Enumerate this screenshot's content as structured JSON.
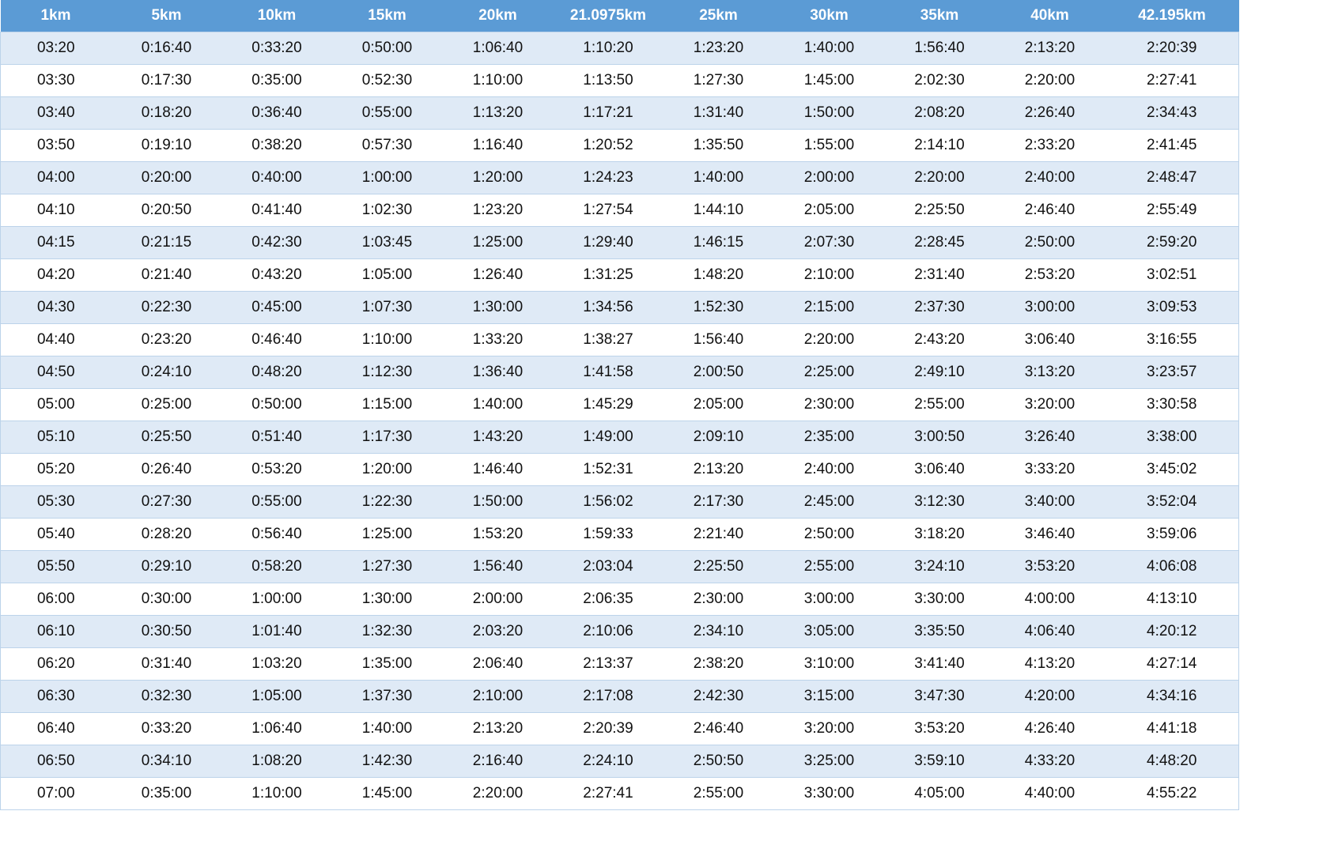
{
  "colors": {
    "header_bg": "#5b9bd5",
    "header_text": "#ffffff",
    "row_alt_bg": "#dfeaf6",
    "row_bg": "#ffffff",
    "border": "#bcd3ea"
  },
  "table": {
    "headers": [
      "1km",
      "5km",
      "10km",
      "15km",
      "20km",
      "21.0975km",
      "25km",
      "30km",
      "35km",
      "40km",
      "42.195km"
    ],
    "rows": [
      [
        "03:20",
        "0:16:40",
        "0:33:20",
        "0:50:00",
        "1:06:40",
        "1:10:20",
        "1:23:20",
        "1:40:00",
        "1:56:40",
        "2:13:20",
        "2:20:39"
      ],
      [
        "03:30",
        "0:17:30",
        "0:35:00",
        "0:52:30",
        "1:10:00",
        "1:13:50",
        "1:27:30",
        "1:45:00",
        "2:02:30",
        "2:20:00",
        "2:27:41"
      ],
      [
        "03:40",
        "0:18:20",
        "0:36:40",
        "0:55:00",
        "1:13:20",
        "1:17:21",
        "1:31:40",
        "1:50:00",
        "2:08:20",
        "2:26:40",
        "2:34:43"
      ],
      [
        "03:50",
        "0:19:10",
        "0:38:20",
        "0:57:30",
        "1:16:40",
        "1:20:52",
        "1:35:50",
        "1:55:00",
        "2:14:10",
        "2:33:20",
        "2:41:45"
      ],
      [
        "04:00",
        "0:20:00",
        "0:40:00",
        "1:00:00",
        "1:20:00",
        "1:24:23",
        "1:40:00",
        "2:00:00",
        "2:20:00",
        "2:40:00",
        "2:48:47"
      ],
      [
        "04:10",
        "0:20:50",
        "0:41:40",
        "1:02:30",
        "1:23:20",
        "1:27:54",
        "1:44:10",
        "2:05:00",
        "2:25:50",
        "2:46:40",
        "2:55:49"
      ],
      [
        "04:15",
        "0:21:15",
        "0:42:30",
        "1:03:45",
        "1:25:00",
        "1:29:40",
        "1:46:15",
        "2:07:30",
        "2:28:45",
        "2:50:00",
        "2:59:20"
      ],
      [
        "04:20",
        "0:21:40",
        "0:43:20",
        "1:05:00",
        "1:26:40",
        "1:31:25",
        "1:48:20",
        "2:10:00",
        "2:31:40",
        "2:53:20",
        "3:02:51"
      ],
      [
        "04:30",
        "0:22:30",
        "0:45:00",
        "1:07:30",
        "1:30:00",
        "1:34:56",
        "1:52:30",
        "2:15:00",
        "2:37:30",
        "3:00:00",
        "3:09:53"
      ],
      [
        "04:40",
        "0:23:20",
        "0:46:40",
        "1:10:00",
        "1:33:20",
        "1:38:27",
        "1:56:40",
        "2:20:00",
        "2:43:20",
        "3:06:40",
        "3:16:55"
      ],
      [
        "04:50",
        "0:24:10",
        "0:48:20",
        "1:12:30",
        "1:36:40",
        "1:41:58",
        "2:00:50",
        "2:25:00",
        "2:49:10",
        "3:13:20",
        "3:23:57"
      ],
      [
        "05:00",
        "0:25:00",
        "0:50:00",
        "1:15:00",
        "1:40:00",
        "1:45:29",
        "2:05:00",
        "2:30:00",
        "2:55:00",
        "3:20:00",
        "3:30:58"
      ],
      [
        "05:10",
        "0:25:50",
        "0:51:40",
        "1:17:30",
        "1:43:20",
        "1:49:00",
        "2:09:10",
        "2:35:00",
        "3:00:50",
        "3:26:40",
        "3:38:00"
      ],
      [
        "05:20",
        "0:26:40",
        "0:53:20",
        "1:20:00",
        "1:46:40",
        "1:52:31",
        "2:13:20",
        "2:40:00",
        "3:06:40",
        "3:33:20",
        "3:45:02"
      ],
      [
        "05:30",
        "0:27:30",
        "0:55:00",
        "1:22:30",
        "1:50:00",
        "1:56:02",
        "2:17:30",
        "2:45:00",
        "3:12:30",
        "3:40:00",
        "3:52:04"
      ],
      [
        "05:40",
        "0:28:20",
        "0:56:40",
        "1:25:00",
        "1:53:20",
        "1:59:33",
        "2:21:40",
        "2:50:00",
        "3:18:20",
        "3:46:40",
        "3:59:06"
      ],
      [
        "05:50",
        "0:29:10",
        "0:58:20",
        "1:27:30",
        "1:56:40",
        "2:03:04",
        "2:25:50",
        "2:55:00",
        "3:24:10",
        "3:53:20",
        "4:06:08"
      ],
      [
        "06:00",
        "0:30:00",
        "1:00:00",
        "1:30:00",
        "2:00:00",
        "2:06:35",
        "2:30:00",
        "3:00:00",
        "3:30:00",
        "4:00:00",
        "4:13:10"
      ],
      [
        "06:10",
        "0:30:50",
        "1:01:40",
        "1:32:30",
        "2:03:20",
        "2:10:06",
        "2:34:10",
        "3:05:00",
        "3:35:50",
        "4:06:40",
        "4:20:12"
      ],
      [
        "06:20",
        "0:31:40",
        "1:03:20",
        "1:35:00",
        "2:06:40",
        "2:13:37",
        "2:38:20",
        "3:10:00",
        "3:41:40",
        "4:13:20",
        "4:27:14"
      ],
      [
        "06:30",
        "0:32:30",
        "1:05:00",
        "1:37:30",
        "2:10:00",
        "2:17:08",
        "2:42:30",
        "3:15:00",
        "3:47:30",
        "4:20:00",
        "4:34:16"
      ],
      [
        "06:40",
        "0:33:20",
        "1:06:40",
        "1:40:00",
        "2:13:20",
        "2:20:39",
        "2:46:40",
        "3:20:00",
        "3:53:20",
        "4:26:40",
        "4:41:18"
      ],
      [
        "06:50",
        "0:34:10",
        "1:08:20",
        "1:42:30",
        "2:16:40",
        "2:24:10",
        "2:50:50",
        "3:25:00",
        "3:59:10",
        "4:33:20",
        "4:48:20"
      ],
      [
        "07:00",
        "0:35:00",
        "1:10:00",
        "1:45:00",
        "2:20:00",
        "2:27:41",
        "2:55:00",
        "3:30:00",
        "4:05:00",
        "4:40:00",
        "4:55:22"
      ]
    ]
  }
}
